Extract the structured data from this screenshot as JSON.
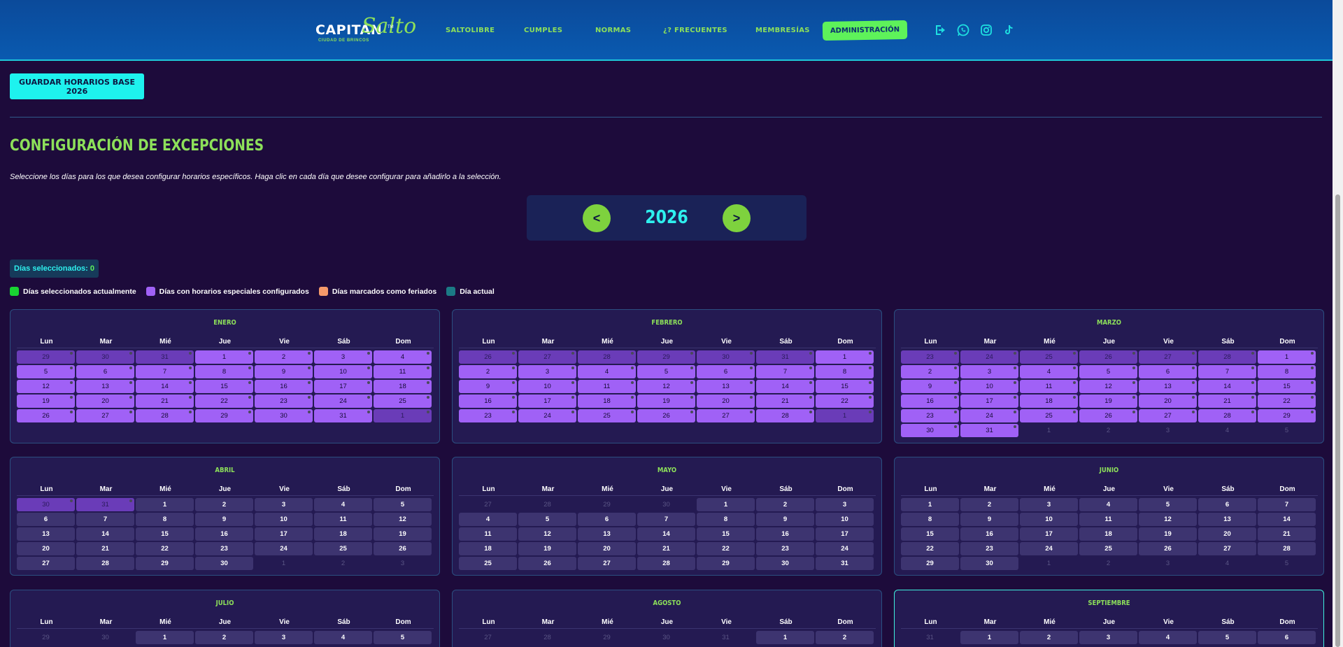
{
  "header": {
    "logo": {
      "main": "CAPITÁN",
      "script": "Salto",
      "tm": "TM",
      "sub": "CIUDAD DE BRINCOS"
    },
    "nav": [
      {
        "label": "SALTOLIBRE",
        "name": "nav-saltolibre"
      },
      {
        "label": "CUMPLES",
        "name": "nav-cumples"
      },
      {
        "label": "NORMAS",
        "name": "nav-normas"
      },
      {
        "label": "¿? FRECUENTES",
        "name": "nav-frecuentes"
      },
      {
        "label": "MEMBRESÍAS",
        "name": "nav-membresias"
      }
    ],
    "admin_label": "ADMINISTRACIÓN",
    "icons": [
      "logout-icon",
      "whatsapp-icon",
      "instagram-icon",
      "tiktok-icon"
    ]
  },
  "toolbar": {
    "save_label": "GUARDAR HORARIOS BASE 2026"
  },
  "section": {
    "title": "CONFIGURACIÓN DE EXCEPCIONES",
    "instructions": "Seleccione los días para los que desea configurar horarios específicos. Haga clic en cada día que desee configurar para añadirlo a la selección."
  },
  "year_nav": {
    "prev": "<",
    "year": "2026",
    "next": ">"
  },
  "selection": {
    "label": "Días seleccionados:",
    "count": "0"
  },
  "legend": [
    {
      "label": "Días seleccionados actualmente",
      "color": "#19d432"
    },
    {
      "label": "Días con horarios especiales configurados",
      "color": "#a061f6"
    },
    {
      "label": "Días marcados como feriados",
      "color": "#f59a6a"
    },
    {
      "label": "Día actual",
      "color": "#1b7a85"
    }
  ],
  "weekdays": [
    "Lun",
    "Mar",
    "Mié",
    "Jue",
    "Vie",
    "Sáb",
    "Dom"
  ],
  "months": [
    {
      "name": "ENERO",
      "prev_days": [
        29,
        30,
        31
      ],
      "days": 31,
      "next_days": [
        1
      ],
      "special": true,
      "current": false
    },
    {
      "name": "FEBRERO",
      "prev_days": [
        26,
        27,
        28,
        29,
        30,
        31
      ],
      "days": 28,
      "next_days": [
        1
      ],
      "special": true,
      "current": false
    },
    {
      "name": "MARZO",
      "prev_days": [
        23,
        24,
        25,
        26,
        27,
        28
      ],
      "days": 31,
      "next_days": [
        1,
        2,
        3,
        4,
        5
      ],
      "special": true,
      "current": false
    },
    {
      "name": "ABRIL",
      "prev_days": [
        30,
        31
      ],
      "days": 30,
      "next_days": [
        1,
        2,
        3
      ],
      "special": false,
      "current": false
    },
    {
      "name": "MAYO",
      "prev_days": [
        27,
        28,
        29,
        30
      ],
      "days": 31,
      "next_days": [],
      "special": false,
      "current": false
    },
    {
      "name": "JUNIO",
      "prev_days": [],
      "days": 30,
      "next_days": [
        1,
        2,
        3,
        4,
        5
      ],
      "special": false,
      "current": false
    },
    {
      "name": "JULIO",
      "prev_days": [
        29,
        30
      ],
      "days": 5,
      "next_days": [],
      "special": false,
      "current": false
    },
    {
      "name": "AGOSTO",
      "prev_days": [
        27,
        28,
        29,
        30,
        31
      ],
      "days": 2,
      "next_days": [],
      "special": false,
      "current": false
    },
    {
      "name": "SEPTIEMBRE",
      "prev_days": [
        31
      ],
      "days": 6,
      "next_days": [],
      "special": false,
      "current": true
    }
  ]
}
